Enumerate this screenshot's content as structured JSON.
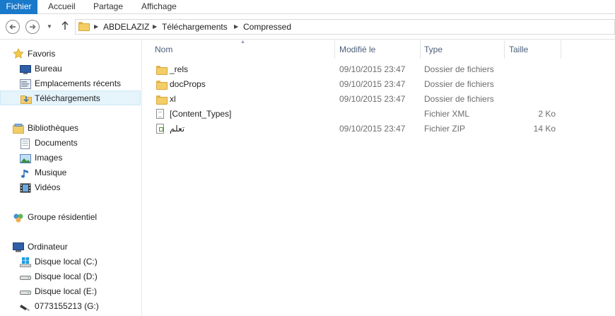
{
  "ribbon": {
    "tabs": [
      {
        "label": "Fichier",
        "active": true
      },
      {
        "label": "Accueil",
        "active": false
      },
      {
        "label": "Partage",
        "active": false
      },
      {
        "label": "Affichage",
        "active": false
      }
    ]
  },
  "address": {
    "crumbs": [
      "ABDELAZIZ",
      "Téléchargements",
      "Compressed"
    ],
    "icons": {
      "back": "back-arrow-icon",
      "forward": "forward-arrow-icon",
      "up": "up-arrow-icon"
    }
  },
  "sidebar": {
    "favoris": {
      "label": "Favoris",
      "items": [
        {
          "label": "Bureau",
          "icon": "desktop-icon"
        },
        {
          "label": "Emplacements récents",
          "icon": "recent-places-icon"
        },
        {
          "label": "Téléchargements",
          "icon": "downloads-icon",
          "selected": true
        }
      ]
    },
    "bibliotheques": {
      "label": "Bibliothèques",
      "items": [
        {
          "label": "Documents",
          "icon": "documents-icon"
        },
        {
          "label": "Images",
          "icon": "images-icon"
        },
        {
          "label": "Musique",
          "icon": "music-icon"
        },
        {
          "label": "Vidéos",
          "icon": "videos-icon"
        }
      ]
    },
    "groupe": {
      "label": "Groupe résidentiel"
    },
    "ordinateur": {
      "label": "Ordinateur",
      "items": [
        {
          "label": "Disque local (C:)",
          "icon": "windows-drive-icon"
        },
        {
          "label": "Disque local (D:)",
          "icon": "drive-icon"
        },
        {
          "label": "Disque local (E:)",
          "icon": "drive-icon"
        },
        {
          "label": "0773155213 (G:)",
          "icon": "usb-drive-icon"
        }
      ]
    }
  },
  "columns": {
    "name": "Nom",
    "modified": "Modifié le",
    "type": "Type",
    "size": "Taille"
  },
  "files": [
    {
      "name": "_rels",
      "modified": "09/10/2015 23:47",
      "type": "Dossier de fichiers",
      "size": "",
      "icon": "folder-icon"
    },
    {
      "name": "docProps",
      "modified": "09/10/2015 23:47",
      "type": "Dossier de fichiers",
      "size": "",
      "icon": "folder-icon"
    },
    {
      "name": "xl",
      "modified": "09/10/2015 23:47",
      "type": "Dossier de fichiers",
      "size": "",
      "icon": "folder-icon"
    },
    {
      "name": "[Content_Types]",
      "modified": "",
      "type": "Fichier XML",
      "size": "2 Ko",
      "icon": "xml-file-icon"
    },
    {
      "name": "تعلم",
      "modified": "09/10/2015 23:47",
      "type": "Fichier ZIP",
      "size": "14 Ko",
      "icon": "zip-file-icon"
    }
  ],
  "colors": {
    "accent": "#1979ca",
    "selected_bg": "#e5f3fb",
    "header_text": "#4c607a"
  }
}
